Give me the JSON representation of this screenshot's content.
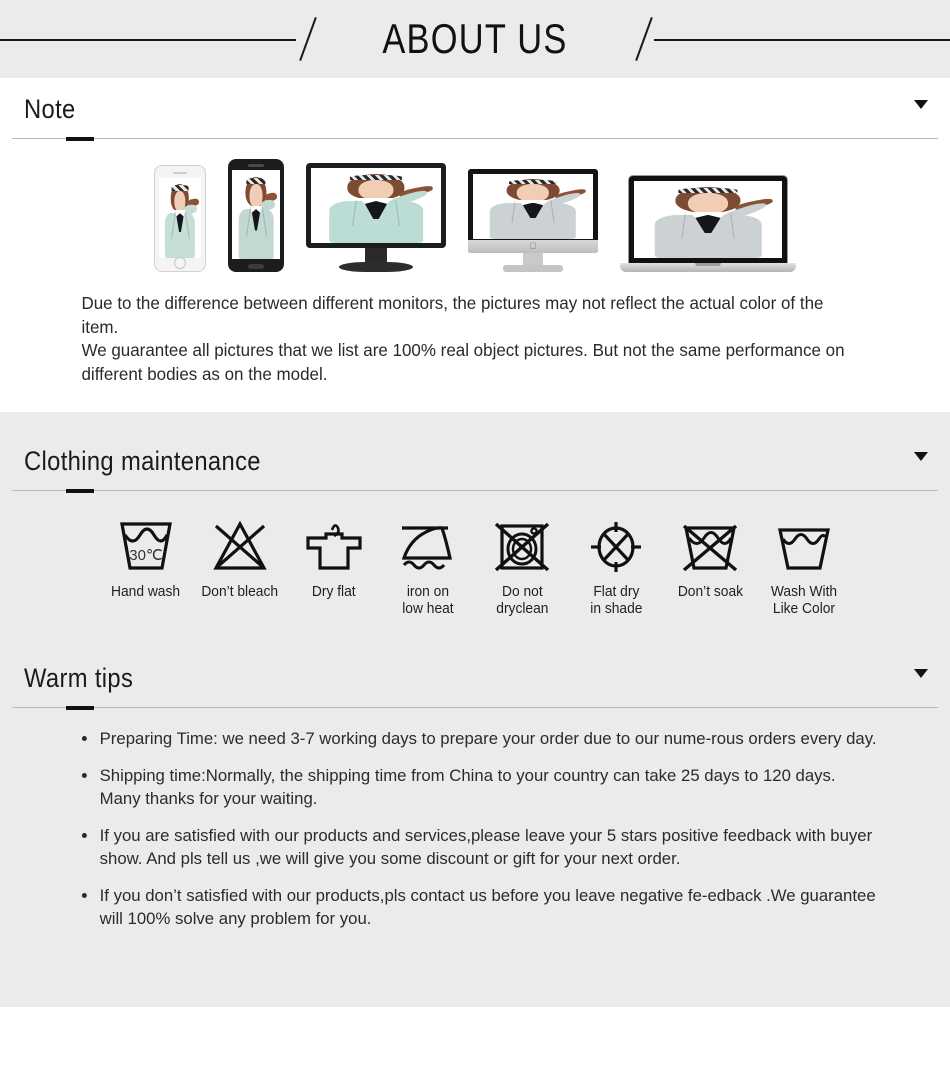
{
  "banner": {
    "title": "ABOUT US"
  },
  "sections": [
    {
      "key": "note",
      "title": "Note",
      "caret": "chevron-down-icon"
    },
    {
      "key": "clothing_maintenance",
      "title": "Clothing maintenance",
      "caret": "chevron-down-icon"
    },
    {
      "key": "warm_tips",
      "title": "Warm tips",
      "caret": "chevron-down-icon"
    }
  ],
  "note": {
    "devices": [
      {
        "name": "iphone-mockup",
        "coat_color": "#c6ded6"
      },
      {
        "name": "android-phone-mockup",
        "coat_color": "#c3d8d2"
      },
      {
        "name": "desktop-monitor-mockup",
        "coat_color": "#bcdcd6"
      },
      {
        "name": "imac-mockup",
        "coat_color": "#ccd2d4"
      },
      {
        "name": "macbook-mockup",
        "coat_color": "#ccd1d3"
      }
    ],
    "paragraph_1": "Due to the difference between different monitors, the pictures may not reflect the actual color of the item.",
    "paragraph_2": "We guarantee all pictures that we list are 100% real object pictures. But not the same performance on different bodies as on the model."
  },
  "care": {
    "icons": [
      {
        "icon": "hand-wash-icon",
        "label": "Hand wash",
        "temperature": "30℃"
      },
      {
        "icon": "do-not-bleach-icon",
        "label": "Don’t bleach"
      },
      {
        "icon": "dry-flat-icon",
        "label": "Dry flat"
      },
      {
        "icon": "iron-low-heat-icon",
        "label": "iron on\nlow heat"
      },
      {
        "icon": "do-not-dryclean-icon",
        "label": "Do not\ndryclean"
      },
      {
        "icon": "flat-dry-shade-icon",
        "label": "Flat dry\nin shade"
      },
      {
        "icon": "do-not-soak-icon",
        "label": "Don’t soak"
      },
      {
        "icon": "wash-like-color-icon",
        "label": "Wash With\nLike Color"
      }
    ]
  },
  "tips": {
    "items": [
      "Preparing Time: we need 3-7 working days to prepare your order due to our nume-rous orders every day.",
      "Shipping time:Normally, the shipping time from China to your country can take 25 days to 120 days. Many thanks for your waiting.",
      "If you are satisfied with our products and services,please leave your 5 stars positive feedback with buyer show. And pls tell us ,we will give you some discount or gift for your next order.",
      "If you don’t satisfied with our products,pls contact us before you leave negative fe-edback .We guarantee will 100% solve any problem for you."
    ]
  },
  "colors": {
    "banner_bg": "#ebebe9",
    "section_gray": "#ebebe9",
    "section_white": "#ffffff",
    "ink": "#1a1a1a",
    "rule": "#b9b9b7"
  }
}
